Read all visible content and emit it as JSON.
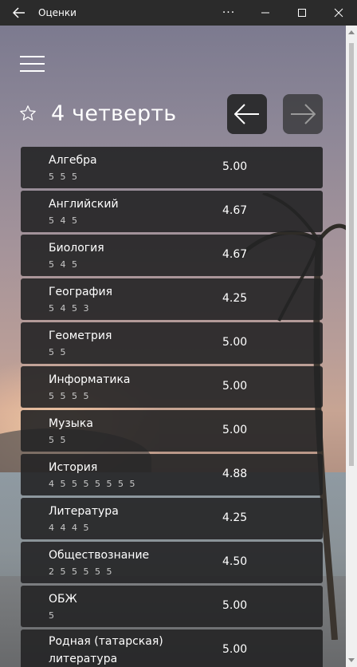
{
  "window": {
    "title": "Оценки",
    "more_label": "···",
    "minimize_label": "—",
    "close_label": "✕"
  },
  "header": {
    "title": "4 четверть"
  },
  "subjects": [
    {
      "name": "Алгебра",
      "grades": "5 5 5",
      "average": "5.00"
    },
    {
      "name": "Английский",
      "grades": "5 4 5",
      "average": "4.67"
    },
    {
      "name": "Биология",
      "grades": "5 4 5",
      "average": "4.67"
    },
    {
      "name": "География",
      "grades": "5 4 5 3",
      "average": "4.25"
    },
    {
      "name": "Геометрия",
      "grades": "5 5",
      "average": "5.00"
    },
    {
      "name": "Информатика",
      "grades": "5 5 5 5",
      "average": "5.00"
    },
    {
      "name": "Музыка",
      "grades": "5 5",
      "average": "5.00"
    },
    {
      "name": "История",
      "grades": "4 5 5 5 5 5 5 5",
      "average": "4.88"
    },
    {
      "name": "Литература",
      "grades": "4 4 4 5",
      "average": "4.25"
    },
    {
      "name": "Обществознание",
      "grades": "2 5 5 5 5 5",
      "average": "4.50"
    },
    {
      "name": "ОБЖ",
      "grades": "5",
      "average": "5.00"
    },
    {
      "name": "Родная (татарская) литература",
      "grades": "",
      "average": "5.00"
    }
  ],
  "icons": {
    "back": "arrow-left-icon",
    "menu": "hamburger-icon",
    "star": "star-icon",
    "prev": "arrow-left-icon",
    "next": "arrow-right-icon"
  }
}
